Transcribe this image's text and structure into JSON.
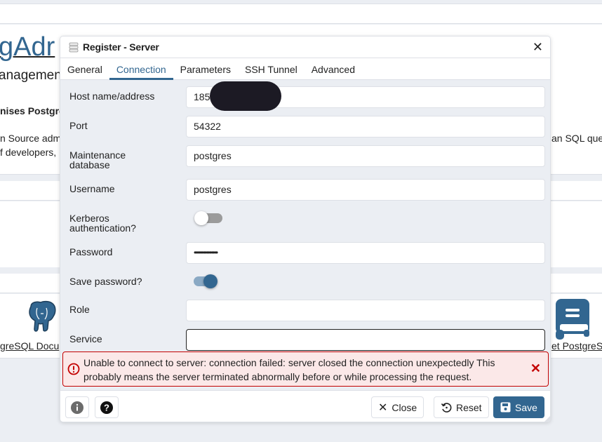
{
  "background": {
    "logo_text": "gAdr",
    "subtitle": "anagement",
    "bold_line": "nises Postgre",
    "text_line1": "n Source adm",
    "text_line2": "f developers,",
    "text_right": "an SQL que",
    "link_left": "greSQL Docu",
    "link_right": "et PostgreS",
    "accent_color": "#326690"
  },
  "dialog": {
    "title": "Register - Server",
    "tabs": [
      {
        "label": "General",
        "active": false
      },
      {
        "label": "Connection",
        "active": true
      },
      {
        "label": "Parameters",
        "active": false
      },
      {
        "label": "SSH Tunnel",
        "active": false
      },
      {
        "label": "Advanced",
        "active": false
      }
    ],
    "fields": {
      "host": {
        "label": "Host name/address",
        "value": "185"
      },
      "port": {
        "label": "Port",
        "value": "54322"
      },
      "maintenance_db": {
        "label_line1": "Maintenance",
        "label_line2": "database",
        "value": "postgres"
      },
      "username": {
        "label": "Username",
        "value": "postgres"
      },
      "kerberos": {
        "label_line1": "Kerberos",
        "label_line2": "authentication?",
        "enabled": false
      },
      "password": {
        "label": "Password",
        "value": "•••••••••••••••"
      },
      "save_password": {
        "label": "Save password?",
        "enabled": true
      },
      "role": {
        "label": "Role",
        "value": ""
      },
      "service": {
        "label": "Service",
        "value": ""
      }
    },
    "error": {
      "message": "Unable to connect to server: connection failed: server closed the connection unexpectedly This probably means the server terminated abnormally before or while processing the request.",
      "color": "#c30000"
    },
    "footer": {
      "close_label": "Close",
      "reset_label": "Reset",
      "save_label": "Save"
    }
  }
}
